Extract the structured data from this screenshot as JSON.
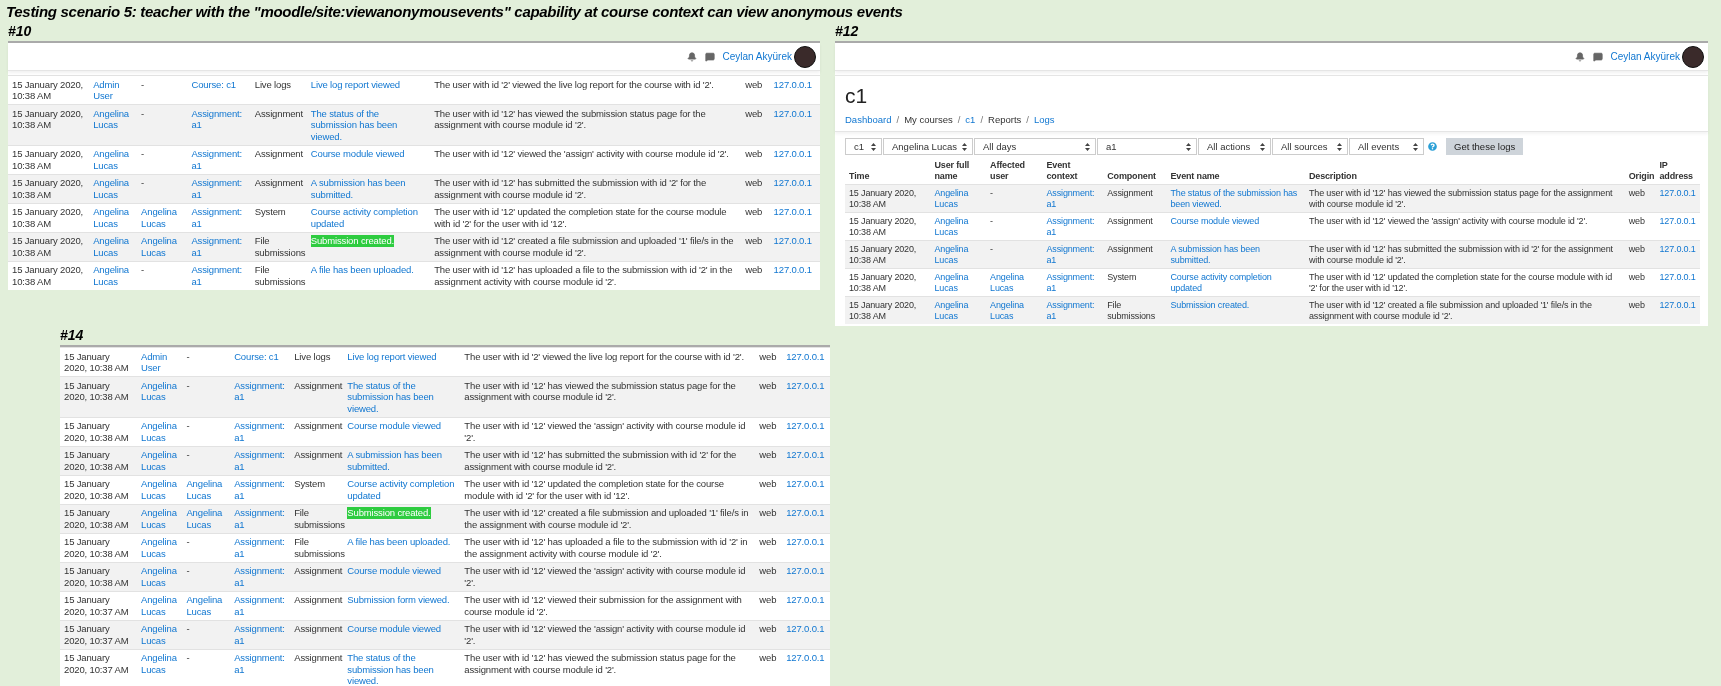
{
  "title": "Testing scenario 5: teacher with the \"moodle/site:viewanonymousevents\" capability at course context can view anonymous events",
  "panels": [
    {
      "kind": "log-list",
      "label": "#10",
      "header": {
        "user": "Ceylan Akyürek"
      },
      "rows": [
        {
          "time": "15 January 2020, 10:38 AM",
          "user": "Admin User",
          "affected": "-",
          "affected_link": false,
          "context": "Course: c1",
          "component": "Live logs",
          "event": "Live log report viewed",
          "highlighted": false,
          "description": "The user with id '2' viewed the live log report for the course with id '2'.",
          "origin": "web",
          "ip": "127.0.0.1"
        },
        {
          "time": "15 January 2020, 10:38 AM",
          "user": "Angelina Lucas",
          "affected": "-",
          "affected_link": false,
          "context": "Assignment: a1",
          "component": "Assignment",
          "event": "The status of the submission has been viewed.",
          "highlighted": false,
          "description": "The user with id '12' has viewed the submission status page for the assignment with course module id '2'.",
          "origin": "web",
          "ip": "127.0.0.1"
        },
        {
          "time": "15 January 2020, 10:38 AM",
          "user": "Angelina Lucas",
          "affected": "-",
          "affected_link": false,
          "context": "Assignment: a1",
          "component": "Assignment",
          "event": "Course module viewed",
          "highlighted": false,
          "description": "The user with id '12' viewed the 'assign' activity with course module id '2'.",
          "origin": "web",
          "ip": "127.0.0.1"
        },
        {
          "time": "15 January 2020, 10:38 AM",
          "user": "Angelina Lucas",
          "affected": "-",
          "affected_link": false,
          "context": "Assignment: a1",
          "component": "Assignment",
          "event": "A submission has been submitted.",
          "highlighted": false,
          "description": "The user with id '12' has submitted the submission with id '2' for the assignment with course module id '2'.",
          "origin": "web",
          "ip": "127.0.0.1"
        },
        {
          "time": "15 January 2020, 10:38 AM",
          "user": "Angelina Lucas",
          "affected": "Angelina Lucas",
          "affected_link": true,
          "context": "Assignment: a1",
          "component": "System",
          "event": "Course activity completion updated",
          "highlighted": false,
          "description": "The user with id '12' updated the completion state for the course module with id '2' for the user with id '12'.",
          "origin": "web",
          "ip": "127.0.0.1"
        },
        {
          "time": "15 January 2020, 10:38 AM",
          "user": "Angelina Lucas",
          "affected": "Angelina Lucas",
          "affected_link": true,
          "context": "Assignment: a1",
          "component": "File submissions",
          "event": "Submission created.",
          "highlighted": true,
          "description": "The user with id '12' created a file submission and uploaded '1' file/s in the assignment with course module id '2'.",
          "origin": "web",
          "ip": "127.0.0.1"
        },
        {
          "time": "15 January 2020, 10:38 AM",
          "user": "Angelina Lucas",
          "affected": "-",
          "affected_link": false,
          "context": "Assignment: a1",
          "component": "File submissions",
          "event": "A file has been uploaded.",
          "highlighted": false,
          "description": "The user with id '12' has uploaded a file to the submission with id '2' in the assignment activity with course module id '2'.",
          "origin": "web",
          "ip": "127.0.0.1"
        }
      ]
    },
    {
      "kind": "report",
      "label": "#12",
      "header": {
        "user": "Ceylan Akyürek"
      },
      "course": "c1",
      "breadcrumb": {
        "separator": "/",
        "items": [
          {
            "text": "Dashboard",
            "link": true
          },
          {
            "text": "My courses",
            "link": false
          },
          {
            "text": "c1",
            "link": true
          },
          {
            "text": "Reports",
            "link": false
          },
          {
            "text": "Logs",
            "link": true
          }
        ]
      },
      "filters": [
        "c1",
        "Angelina Lucas",
        "All days",
        "a1",
        "All actions",
        "All sources",
        "All events"
      ],
      "button": "Get these logs",
      "columns": [
        "Time",
        "User full name",
        "Affected user",
        "Event context",
        "Component",
        "Event name",
        "Description",
        "Origin",
        "IP address"
      ],
      "rows": [
        {
          "time": "15 January 2020, 10:38 AM",
          "user": "Angelina Lucas",
          "affected": "-",
          "affected_link": false,
          "context": "Assignment: a1",
          "component": "Assignment",
          "event": "The status of the submission has been viewed.",
          "highlighted": false,
          "description": "The user with id '12' has viewed the submission status page for the assignment with course module id '2'.",
          "origin": "web",
          "ip": "127.0.0.1"
        },
        {
          "time": "15 January 2020, 10:38 AM",
          "user": "Angelina Lucas",
          "affected": "-",
          "affected_link": false,
          "context": "Assignment: a1",
          "component": "Assignment",
          "event": "Course module viewed",
          "highlighted": false,
          "description": "The user with id '12' viewed the 'assign' activity with course module id '2'.",
          "origin": "web",
          "ip": "127.0.0.1"
        },
        {
          "time": "15 January 2020, 10:38 AM",
          "user": "Angelina Lucas",
          "affected": "-",
          "affected_link": false,
          "context": "Assignment: a1",
          "component": "Assignment",
          "event": "A submission has been submitted.",
          "highlighted": false,
          "description": "The user with id '12' has submitted the submission with id '2' for the assignment with course module id '2'.",
          "origin": "web",
          "ip": "127.0.0.1"
        },
        {
          "time": "15 January 2020, 10:38 AM",
          "user": "Angelina Lucas",
          "affected": "Angelina Lucas",
          "affected_link": true,
          "context": "Assignment: a1",
          "component": "System",
          "event": "Course activity completion updated",
          "highlighted": false,
          "description": "The user with id '12' updated the completion state for the course module with id '2' for the user with id '12'.",
          "origin": "web",
          "ip": "127.0.0.1"
        },
        {
          "time": "15 January 2020, 10:38 AM",
          "user": "Angelina Lucas",
          "affected": "Angelina Lucas",
          "affected_link": true,
          "context": "Assignment: a1",
          "component": "File submissions",
          "event": "Submission created.",
          "highlighted": false,
          "description": "The user with id '12' created a file submission and uploaded '1' file/s in the assignment with course module id '2'.",
          "origin": "web",
          "ip": "127.0.0.1"
        }
      ]
    },
    {
      "kind": "log-list",
      "label": "#14",
      "rows": [
        {
          "time": "15 January 2020, 10:38 AM",
          "user": "Admin User",
          "affected": "-",
          "affected_link": false,
          "context": "Course: c1",
          "component": "Live logs",
          "event": "Live log report viewed",
          "highlighted": false,
          "description": "The user with id '2' viewed the live log report for the course with id '2'.",
          "origin": "web",
          "ip": "127.0.0.1"
        },
        {
          "time": "15 January 2020, 10:38 AM",
          "user": "Angelina Lucas",
          "affected": "-",
          "affected_link": false,
          "context": "Assignment: a1",
          "component": "Assignment",
          "event": "The status of the submission has been viewed.",
          "highlighted": false,
          "description": "The user with id '12' has viewed the submission status page for the assignment with course module id '2'.",
          "origin": "web",
          "ip": "127.0.0.1"
        },
        {
          "time": "15 January 2020, 10:38 AM",
          "user": "Angelina Lucas",
          "affected": "-",
          "affected_link": false,
          "context": "Assignment: a1",
          "component": "Assignment",
          "event": "Course module viewed",
          "highlighted": false,
          "description": "The user with id '12' viewed the 'assign' activity with course module id '2'.",
          "origin": "web",
          "ip": "127.0.0.1"
        },
        {
          "time": "15 January 2020, 10:38 AM",
          "user": "Angelina Lucas",
          "affected": "-",
          "affected_link": false,
          "context": "Assignment: a1",
          "component": "Assignment",
          "event": "A submission has been submitted.",
          "highlighted": false,
          "description": "The user with id '12' has submitted the submission with id '2' for the assignment with course module id '2'.",
          "origin": "web",
          "ip": "127.0.0.1"
        },
        {
          "time": "15 January 2020, 10:38 AM",
          "user": "Angelina Lucas",
          "affected": "Angelina Lucas",
          "affected_link": true,
          "context": "Assignment: a1",
          "component": "System",
          "event": "Course activity completion updated",
          "highlighted": false,
          "description": "The user with id '12' updated the completion state for the course module with id '2' for the user with id '12'.",
          "origin": "web",
          "ip": "127.0.0.1"
        },
        {
          "time": "15 January 2020, 10:38 AM",
          "user": "Angelina Lucas",
          "affected": "Angelina Lucas",
          "affected_link": true,
          "context": "Assignment: a1",
          "component": "File submissions",
          "event": "Submission created.",
          "highlighted": true,
          "description": "The user with id '12' created a file submission and uploaded '1' file/s in the assignment with course module id '2'.",
          "origin": "web",
          "ip": "127.0.0.1"
        },
        {
          "time": "15 January 2020, 10:38 AM",
          "user": "Angelina Lucas",
          "affected": "-",
          "affected_link": false,
          "context": "Assignment: a1",
          "component": "File submissions",
          "event": "A file has been uploaded.",
          "highlighted": false,
          "description": "The user with id '12' has uploaded a file to the submission with id '2' in the assignment activity with course module id '2'.",
          "origin": "web",
          "ip": "127.0.0.1"
        },
        {
          "time": "15 January 2020, 10:38 AM",
          "user": "Angelina Lucas",
          "affected": "-",
          "affected_link": false,
          "context": "Assignment: a1",
          "component": "Assignment",
          "event": "Course module viewed",
          "highlighted": false,
          "description": "The user with id '12' viewed the 'assign' activity with course module id '2'.",
          "origin": "web",
          "ip": "127.0.0.1"
        },
        {
          "time": "15 January 2020, 10:37 AM",
          "user": "Angelina Lucas",
          "affected": "Angelina Lucas",
          "affected_link": true,
          "context": "Assignment: a1",
          "component": "Assignment",
          "event": "Submission form viewed.",
          "highlighted": false,
          "description": "The user with id '12' viewed their submission for the assignment with course module id '2'.",
          "origin": "web",
          "ip": "127.0.0.1"
        },
        {
          "time": "15 January 2020, 10:37 AM",
          "user": "Angelina Lucas",
          "affected": "-",
          "affected_link": false,
          "context": "Assignment: a1",
          "component": "Assignment",
          "event": "Course module viewed",
          "highlighted": false,
          "description": "The user with id '12' viewed the 'assign' activity with course module id '2'.",
          "origin": "web",
          "ip": "127.0.0.1"
        },
        {
          "time": "15 January 2020, 10:37 AM",
          "user": "Angelina Lucas",
          "affected": "-",
          "affected_link": false,
          "context": "Assignment: a1",
          "component": "Assignment",
          "event": "The status of the submission has been viewed.",
          "highlighted": false,
          "description": "The user with id '12' has viewed the submission status page for the assignment with course module id '2'.",
          "origin": "web",
          "ip": "127.0.0.1"
        }
      ]
    }
  ]
}
